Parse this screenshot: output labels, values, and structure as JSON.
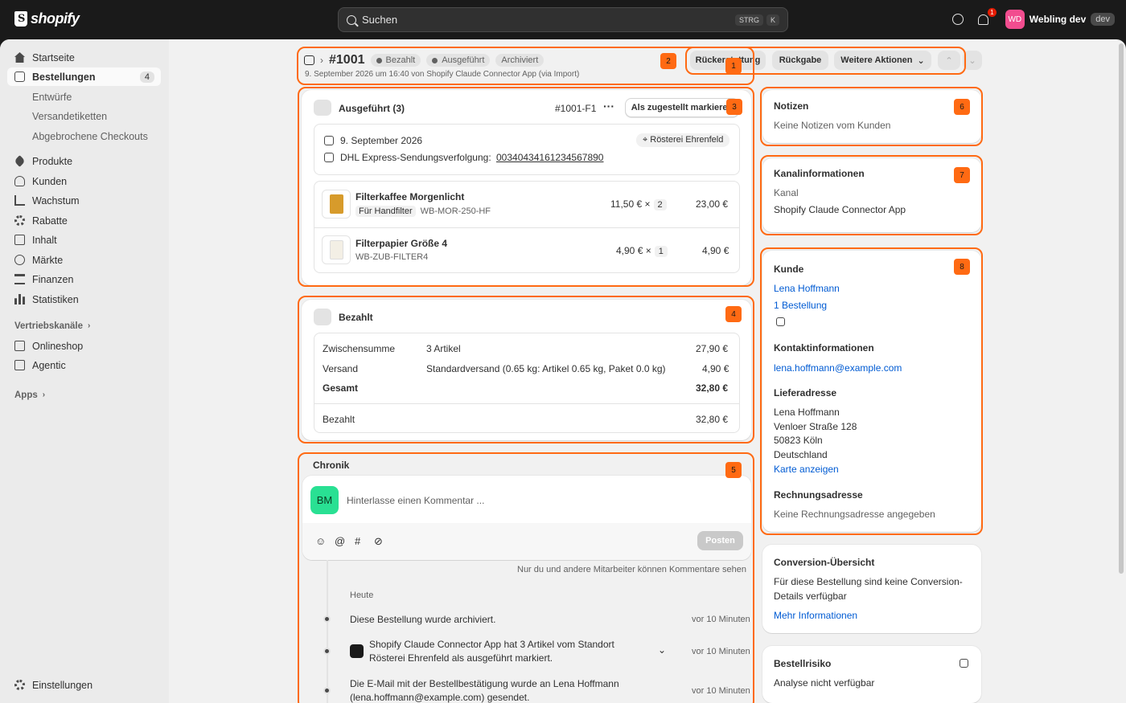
{
  "topbar": {
    "logo_text": "shopify",
    "search_placeholder": "Suchen",
    "kbd_1": "STRG",
    "kbd_2": "K",
    "notification_count": "1",
    "user_initials": "WD",
    "user_name": "Webling dev",
    "env_badge": "dev"
  },
  "sidebar": {
    "home": "Startseite",
    "orders": "Bestellungen",
    "orders_count": "4",
    "drafts": "Entwürfe",
    "shipping_labels": "Versandetiketten",
    "abandoned": "Abgebrochene Checkouts",
    "products": "Produkte",
    "customers": "Kunden",
    "growth": "Wachstum",
    "discounts": "Rabatte",
    "content": "Inhalt",
    "markets": "Märkte",
    "finance": "Finanzen",
    "analytics": "Statistiken",
    "sales_channels": "Vertriebskanäle",
    "online_store": "Onlineshop",
    "agentic": "Agentic",
    "apps": "Apps",
    "settings": "Einstellungen"
  },
  "order": {
    "number": "#1001",
    "badge_paid": "Bezahlt",
    "badge_fulfilled": "Ausgeführt",
    "badge_archived": "Archiviert",
    "subtitle": "9. September 2026 um 16:40 von Shopify Claude Connector App (via Import)",
    "btn_refund": "Rückerstattung",
    "btn_return": "Rückgabe",
    "btn_more": "Weitere Aktionen"
  },
  "fulfillment": {
    "title": "Ausgeführt (3)",
    "id": "#1001-F1",
    "mark_delivered": "Als zugestellt markieren",
    "date": "9. September 2026",
    "location": "Rösterei Ehrenfeld",
    "tracking_label": "DHL Express-Sendungsverfolgung:",
    "tracking_number": "00340434161234567890",
    "items": [
      {
        "name": "Filterkaffee Morgenlicht",
        "variant": "Für Handfilter",
        "sku": "WB-MOR-250-HF",
        "price": "11,50 €",
        "times": "×",
        "qty": "2",
        "total": "23,00 €"
      },
      {
        "name": "Filterpapier Größe 4",
        "variant": "",
        "sku": "WB-ZUB-FILTER4",
        "price": "4,90 €",
        "times": "×",
        "qty": "1",
        "total": "4,90 €"
      }
    ]
  },
  "payment": {
    "title": "Bezahlt",
    "subtotal_label": "Zwischensumme",
    "subtotal_desc": "3 Artikel",
    "subtotal_value": "27,90 €",
    "shipping_label": "Versand",
    "shipping_desc": "Standardversand (0.65 kg: Artikel 0.65 kg, Paket 0.0 kg)",
    "shipping_value": "4,90 €",
    "total_label": "Gesamt",
    "total_value": "32,80 €",
    "paid_label": "Bezahlt",
    "paid_value": "32,80 €"
  },
  "timeline": {
    "title": "Chronik",
    "avatar": "BM",
    "comment_placeholder": "Hinterlasse einen Kommentar ...",
    "post_button": "Posten",
    "visibility_note": "Nur du und andere Mitarbeiter können Kommentare sehen",
    "today": "Heute",
    "events": [
      {
        "text": "Diese Bestellung wurde archiviert.",
        "time": "vor 10 Minuten"
      },
      {
        "text_1": "Shopify Claude Connector App hat 3 Artikel vom Standort",
        "text_2": "Rösterei Ehrenfeld als ausgeführt markiert.",
        "time": "vor 10 Minuten"
      },
      {
        "text_1": "Die E-Mail mit der Bestellbestätigung wurde an Lena Hoffmann",
        "text_2": "(lena.hoffmann@example.com) gesendet.",
        "time": "vor 10 Minuten"
      }
    ]
  },
  "notes": {
    "title": "Notizen",
    "empty": "Keine Notizen vom Kunden"
  },
  "channel": {
    "title": "Kanalinformationen",
    "label": "Kanal",
    "value": "Shopify Claude Connector App"
  },
  "customer": {
    "title": "Kunde",
    "name": "Lena Hoffmann",
    "orders": "1 Bestellung",
    "contact_title": "Kontaktinformationen",
    "email": "lena.hoffmann@example.com",
    "shipping_title": "Lieferadresse",
    "addr_name": "Lena Hoffmann",
    "addr_street": "Venloer Straße 128",
    "addr_city": "50823 Köln",
    "addr_country": "Deutschland",
    "map_link": "Karte anzeigen",
    "billing_title": "Rechnungsadresse",
    "billing_empty": "Keine Rechnungsadresse angegeben"
  },
  "conversion": {
    "title": "Conversion-Übersicht",
    "text_1": "Für diese Bestellung sind keine Conversion-",
    "text_2": "Details verfügbar",
    "link": "Mehr Informationen"
  },
  "risk": {
    "title": "Bestellrisiko",
    "text": "Analyse nicht verfügbar"
  },
  "markers": [
    "1",
    "2",
    "3",
    "4",
    "5",
    "6",
    "7",
    "8"
  ],
  "colors": {
    "highlight": "#ff6a13",
    "link": "#005bd3",
    "avatar_bm": "#29e093",
    "avatar_wd": "#f24d8f"
  }
}
